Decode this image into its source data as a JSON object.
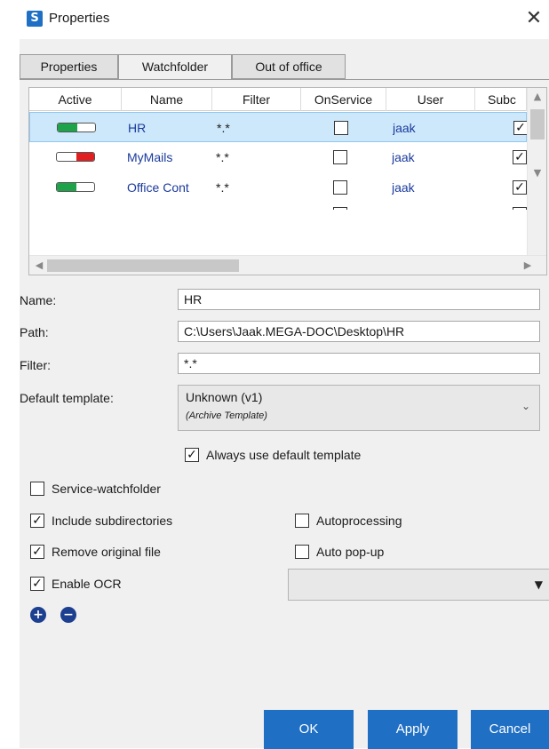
{
  "window": {
    "title": "Properties",
    "app_icon_glyph": "S",
    "close_glyph": "✕"
  },
  "tabs": [
    {
      "label": "Properties",
      "active": false
    },
    {
      "label": "Watchfolder",
      "active": true
    },
    {
      "label": "Out of office",
      "active": false
    }
  ],
  "grid": {
    "columns": [
      "Active",
      "Name",
      "Filter",
      "OnService",
      "User",
      "Subc"
    ],
    "rows": [
      {
        "active": "on",
        "name": "HR",
        "filter": "*.*",
        "onservice": false,
        "user": "jaak",
        "subdirs": true,
        "selected": true
      },
      {
        "active": "off",
        "name": "MyMails",
        "filter": "*.*",
        "onservice": false,
        "user": "jaak",
        "subdirs": true,
        "selected": false
      },
      {
        "active": "on",
        "name": "Office Cont",
        "filter": "*.*",
        "onservice": false,
        "user": "jaak",
        "subdirs": true,
        "selected": false
      }
    ]
  },
  "form": {
    "name_label": "Name:",
    "name_value": "HR",
    "path_label": "Path:",
    "path_value": "C:\\Users\\Jaak.MEGA-DOC\\Desktop\\HR",
    "filter_label": "Filter:",
    "filter_value": "*.*",
    "template_label": "Default template:",
    "template_value": "Unknown (v1)",
    "template_sub": "(Archive Template)",
    "always_default_label": "Always use default template",
    "always_default": true
  },
  "options": {
    "service_watchfolder": {
      "label": "Service-watchfolder",
      "checked": false
    },
    "include_subdirectories": {
      "label": "Include subdirectories",
      "checked": true
    },
    "remove_original": {
      "label": "Remove original file",
      "checked": true
    },
    "enable_ocr": {
      "label": "Enable OCR",
      "checked": true
    },
    "autoprocessing": {
      "label": "Autoprocessing",
      "checked": false
    },
    "auto_popup": {
      "label": "Auto pop-up",
      "checked": false
    },
    "ocr_language_value": ""
  },
  "buttons": {
    "ok": "OK",
    "apply": "Apply",
    "cancel": "Cancel"
  },
  "colors": {
    "accent": "#1f6fc4",
    "toggle_on": "#1ea34a",
    "toggle_off": "#e02020",
    "selection": "#cde8fb"
  }
}
